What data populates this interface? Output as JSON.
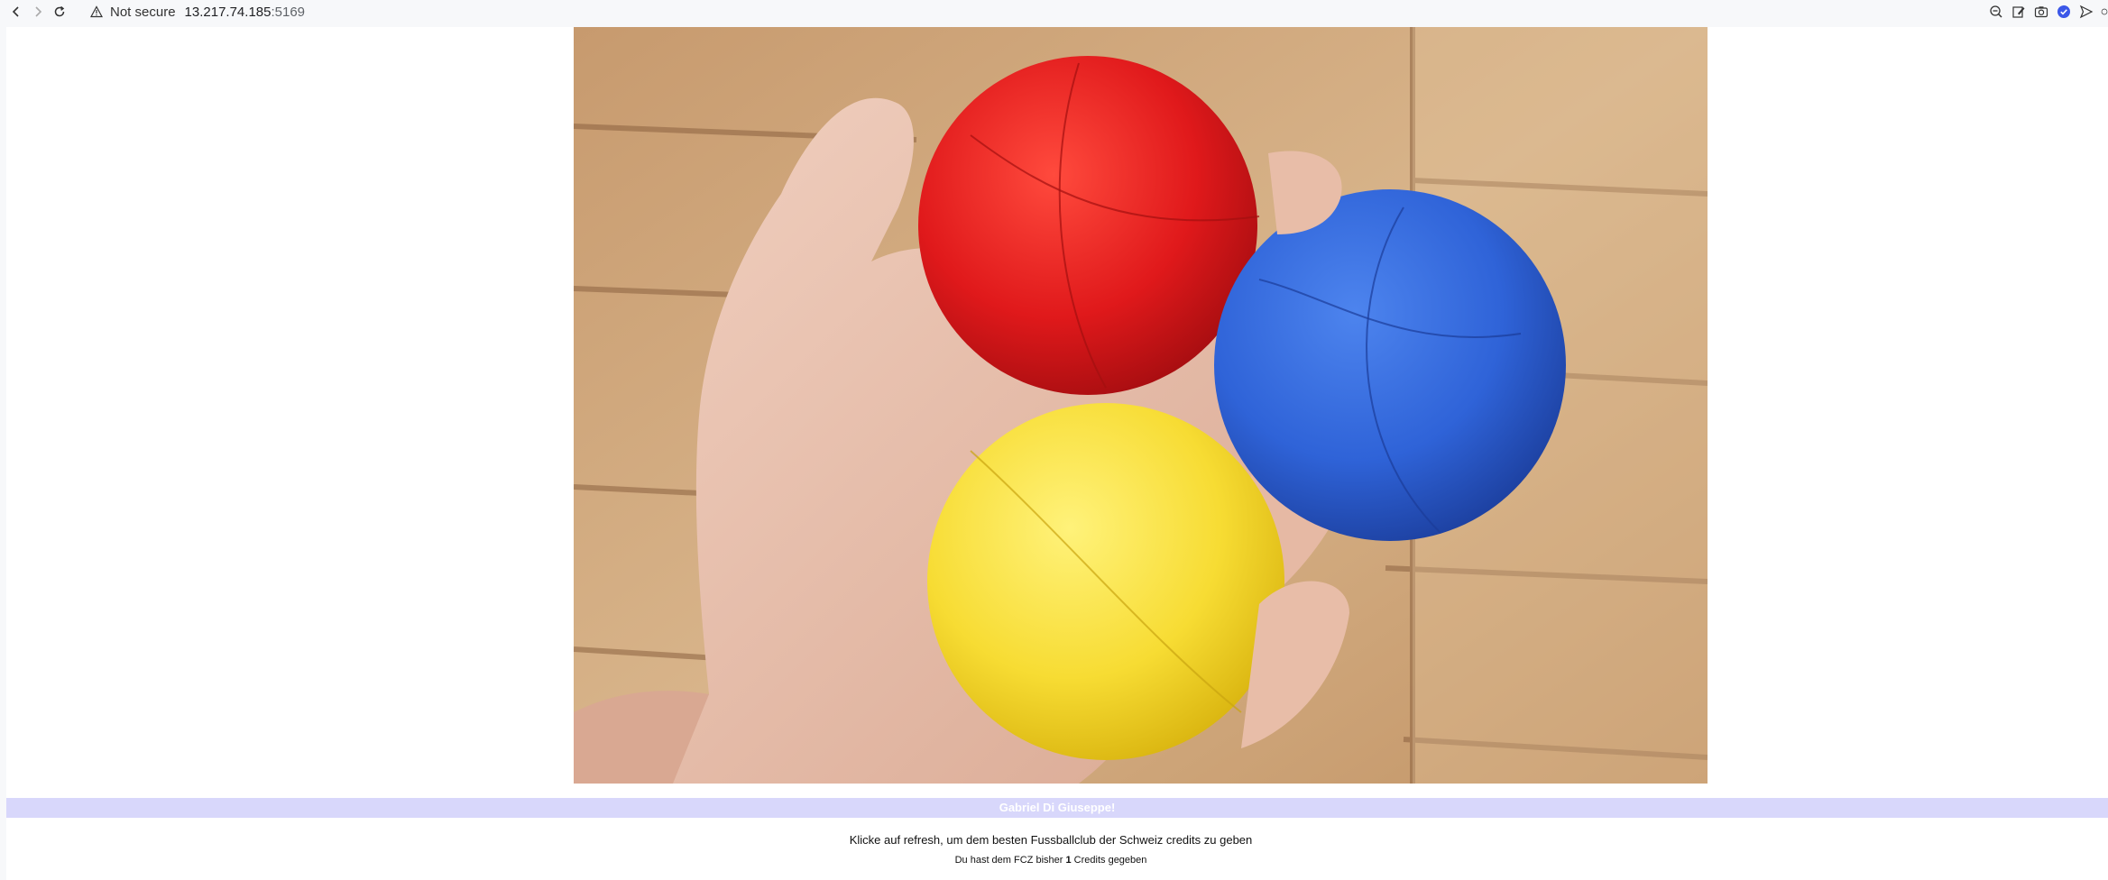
{
  "browser": {
    "security_label": "Not secure",
    "url_host": "13.217.74.185",
    "url_port": ":5169",
    "icons": [
      "back-icon",
      "forward-icon",
      "reload-icon",
      "warning-icon",
      "zoom-out-icon",
      "edit-icon",
      "camera-icon",
      "shield-check-icon",
      "send-icon"
    ]
  },
  "page": {
    "hero_image": "three juggling balls (red, blue, yellow) held in a hand over a wooden background",
    "banner_text": "Gabriel Di Giuseppe!",
    "instruction": "Klicke auf refresh, um dem besten Fussballclub der Schweiz credits zu geben",
    "credits_prefix": "Du hast dem FCZ bisher",
    "credits_count": "1",
    "credits_suffix": "Credits gegeben"
  },
  "colors": {
    "banner_bg": "#d8d7fb",
    "ball_red": "#e0191b",
    "ball_blue": "#2f63d8",
    "ball_yellow": "#f7dc33"
  }
}
